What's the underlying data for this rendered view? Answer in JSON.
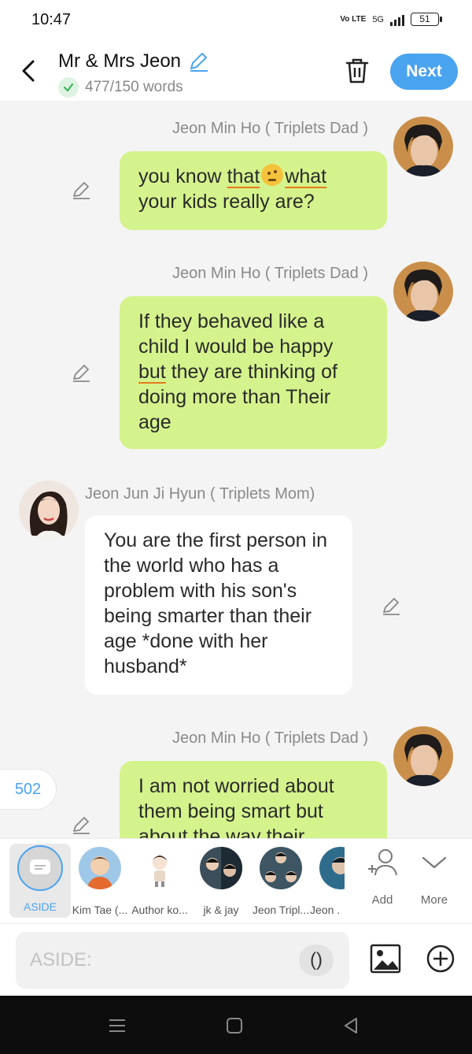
{
  "status_bar": {
    "time": "10:47",
    "network": "5G",
    "volte": "Vo LTE",
    "battery": "51"
  },
  "header": {
    "title": "Mr & Mrs Jeon",
    "word_count": "477/150 words",
    "next_label": "Next"
  },
  "messages": [
    {
      "sender": "Jeon Min Ho ( Triplets Dad )",
      "text_before": "you know ",
      "text_underlined": "that",
      "text_after": "what",
      "text_line2": "your kids really are?"
    },
    {
      "sender": "Jeon Min Ho ( Triplets Dad )",
      "line1": "If they behaved like a",
      "line2": "child I would be happy",
      "underlined": "but",
      "line3_rest": " they are thinking of",
      "line4": "doing more than Their",
      "line5": "age"
    },
    {
      "sender": "Jeon Jun Ji Hyun ( Triplets Mom)",
      "text": "You are the first person in the world who has a problem with his son's being smarter than their age *done with her husband*"
    },
    {
      "sender": "Jeon Min Ho ( Triplets Dad )",
      "text": "I am not worried about them being smart but about the way their"
    }
  ],
  "word_counter_badge": "502",
  "characters": [
    {
      "label": "ASIDE"
    },
    {
      "label": "Kim Tae (..."
    },
    {
      "label": "Author ko..."
    },
    {
      "label": "jk & jay"
    },
    {
      "label": "Jeon Tripl..."
    },
    {
      "label": "Jeon ."
    }
  ],
  "utilities": {
    "add_label": "Add",
    "more_label": "More"
  },
  "input": {
    "placeholder": "ASIDE:",
    "paren_label": "()"
  },
  "colors": {
    "accent": "#4aa3ef",
    "bubble_green": "#d5f38c",
    "bubble_white": "#ffffff",
    "underline": "#e57c1c"
  }
}
